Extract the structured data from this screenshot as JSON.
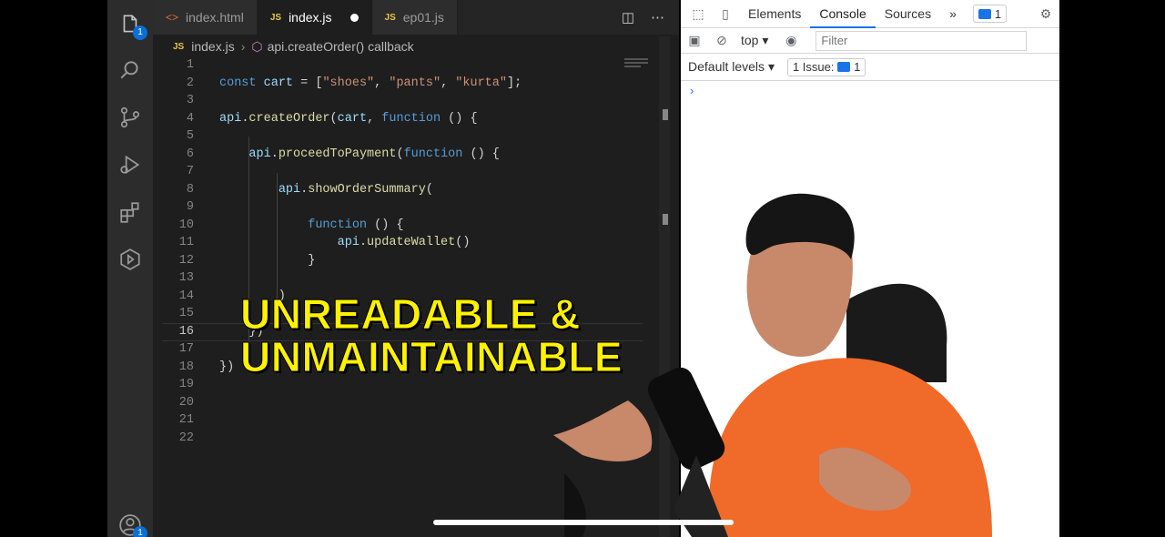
{
  "editor": {
    "tabs": [
      {
        "icon": "<>",
        "label": "index.html",
        "modified": false,
        "active": false
      },
      {
        "icon": "JS",
        "label": "index.js",
        "modified": true,
        "active": true
      },
      {
        "icon": "JS",
        "label": "ep01.js",
        "modified": false,
        "active": false
      }
    ],
    "breadcrumb": {
      "file_icon": "JS",
      "file": "index.js",
      "symbol": "api.createOrder() callback"
    },
    "explorer_badge": "1",
    "accounts_badge": "1",
    "current_line": 16,
    "line_numbers": [
      "1",
      "2",
      "3",
      "4",
      "5",
      "6",
      "7",
      "8",
      "9",
      "10",
      "11",
      "12",
      "13",
      "14",
      "15",
      "16",
      "17",
      "18",
      "19",
      "20",
      "21",
      "22"
    ]
  },
  "overlay_text": {
    "line1": "UNREADABLE &",
    "line2": "UNMAINTAINABLE"
  },
  "devtools": {
    "tabs": [
      "Elements",
      "Console",
      "Sources"
    ],
    "active_tab": "Console",
    "more": "»",
    "issues_badge": "1",
    "context": "top",
    "filter_placeholder": "Filter",
    "levels": "Default levels",
    "issues_label": "1 Issue:",
    "issues_count": "1",
    "prompt": "›"
  },
  "colors": {
    "overlay": "#fff200",
    "keyword": "#569cd6",
    "string": "#ce9178",
    "function": "#dcdcaa",
    "variable": "#9cdcfe"
  }
}
